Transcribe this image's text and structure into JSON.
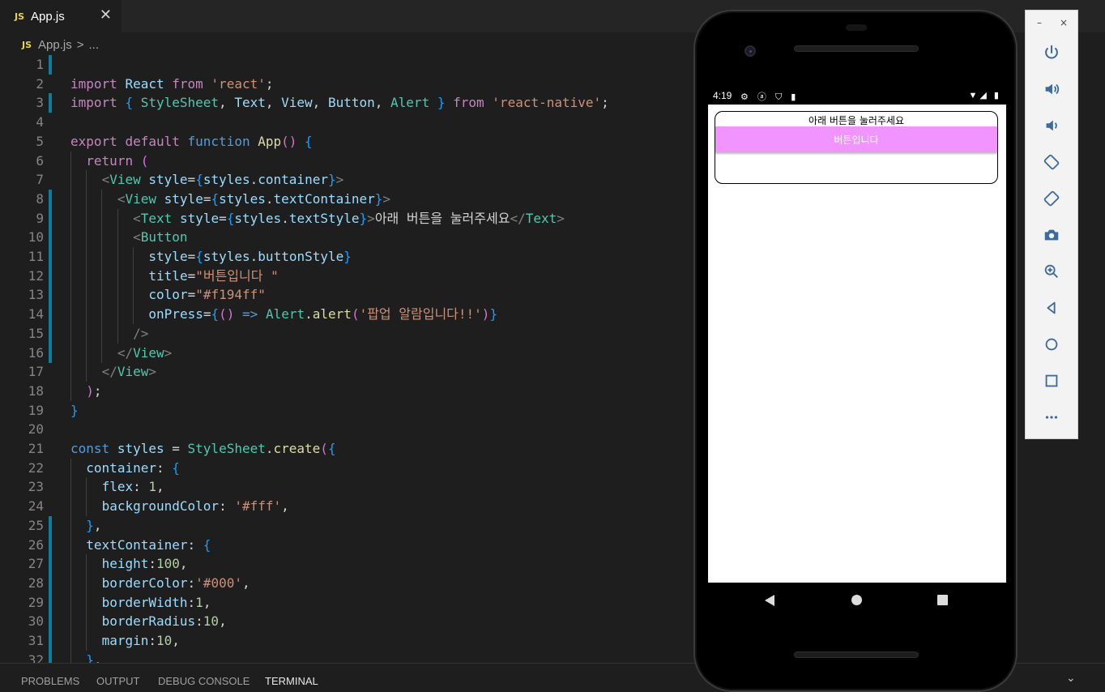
{
  "tab": {
    "badge": "JS",
    "title": "App.js",
    "close": "✕"
  },
  "breadcrumb": {
    "badge": "JS",
    "file": "App.js",
    "sep": ">",
    "more": "..."
  },
  "code_lines": [
    {
      "n": "1",
      "t": ""
    },
    {
      "n": "2",
      "t": "import React from 'react';"
    },
    {
      "n": "3",
      "t": "import { StyleSheet, Text, View, Button, Alert } from 'react-native';"
    },
    {
      "n": "4",
      "t": ""
    },
    {
      "n": "5",
      "t": "export default function App() {"
    },
    {
      "n": "6",
      "t": "  return ("
    },
    {
      "n": "7",
      "t": "    <View style={styles.container}>"
    },
    {
      "n": "8",
      "t": "      <View style={styles.textContainer}>"
    },
    {
      "n": "9",
      "t": "        <Text style={styles.textStyle}>아래 버튼을 눌러주세요</Text>"
    },
    {
      "n": "10",
      "t": "        <Button"
    },
    {
      "n": "11",
      "t": "          style={styles.buttonStyle}"
    },
    {
      "n": "12",
      "t": "          title=\"버튼입니다 \""
    },
    {
      "n": "13",
      "t": "          color=\"#f194ff\""
    },
    {
      "n": "14",
      "t": "          onPress={() => Alert.alert('팝업 알람입니다!!')}"
    },
    {
      "n": "15",
      "t": "        />"
    },
    {
      "n": "16",
      "t": "      </View>"
    },
    {
      "n": "17",
      "t": "    </View>"
    },
    {
      "n": "18",
      "t": "  );"
    },
    {
      "n": "19",
      "t": "}"
    },
    {
      "n": "20",
      "t": ""
    },
    {
      "n": "21",
      "t": "const styles = StyleSheet.create({"
    },
    {
      "n": "22",
      "t": "  container: {"
    },
    {
      "n": "23",
      "t": "    flex: 1,"
    },
    {
      "n": "24",
      "t": "    backgroundColor: '#fff',"
    },
    {
      "n": "25",
      "t": "  },"
    },
    {
      "n": "26",
      "t": "  textContainer: {"
    },
    {
      "n": "27",
      "t": "    height:100,"
    },
    {
      "n": "28",
      "t": "    borderColor:'#000',"
    },
    {
      "n": "29",
      "t": "    borderWidth:1,"
    },
    {
      "n": "30",
      "t": "    borderRadius:10,"
    },
    {
      "n": "31",
      "t": "    margin:10,"
    },
    {
      "n": "32",
      "t": "  },"
    }
  ],
  "panel": {
    "tabs": [
      "PROBLEMS",
      "OUTPUT",
      "DEBUG CONSOLE",
      "TERMINAL"
    ],
    "active": "TERMINAL"
  },
  "phone": {
    "status": {
      "time": "4:19",
      "left_icons": "⚙ ⓐ ⛉ ▮",
      "right_icons": "▼◢ ▮"
    },
    "app": {
      "text": "아래 버튼을 눌러주세요",
      "button_title": "버튼입니다",
      "button_color": "#f194ff"
    }
  },
  "emulator_toolbar": {
    "window": {
      "minimize": "–",
      "close": "×"
    },
    "buttons": [
      "power-icon",
      "volume-up-icon",
      "volume-down-icon",
      "rotate-left-icon",
      "rotate-right-icon",
      "camera-icon",
      "zoom-icon",
      "back-icon",
      "home-icon",
      "overview-icon",
      "more-icon"
    ]
  }
}
